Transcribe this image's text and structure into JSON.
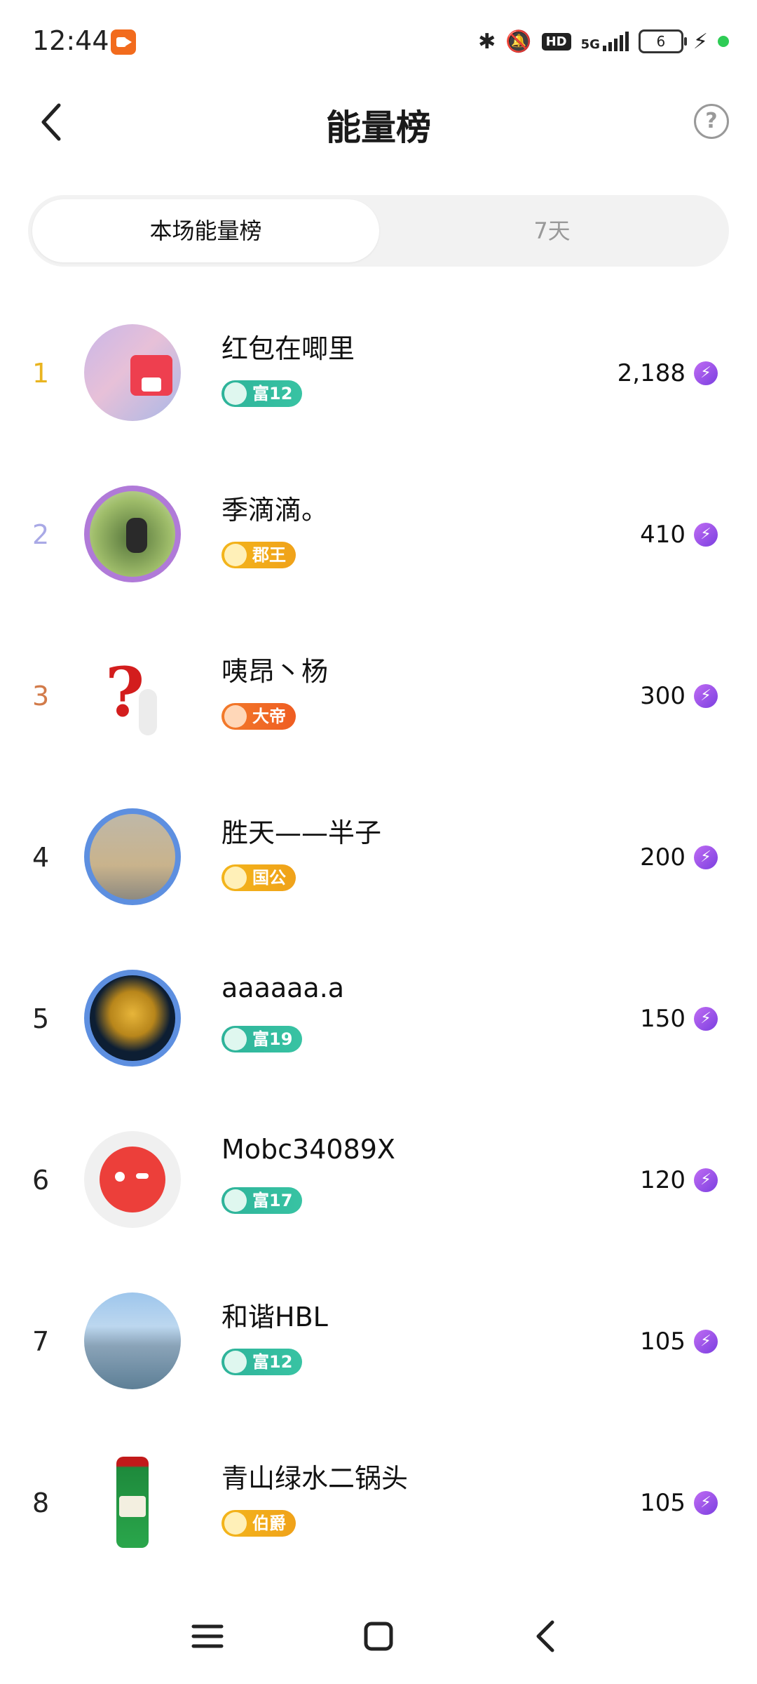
{
  "status_bar": {
    "time": "12:44",
    "signal": "5G",
    "hd": "HD",
    "battery_level": "6"
  },
  "header": {
    "title": "能量榜",
    "help": "?"
  },
  "tabs": [
    {
      "label": "本场能量榜",
      "active": true
    },
    {
      "label": "7天",
      "active": false
    }
  ],
  "ranking": [
    {
      "rank": "1",
      "name": "红包在唧里",
      "badge": "富12",
      "badge_style": "teal",
      "score": "2,188"
    },
    {
      "rank": "2",
      "name": "季滴滴。",
      "badge": "郡王",
      "badge_style": "gold",
      "score": "410"
    },
    {
      "rank": "3",
      "name": "咦昂丶杨",
      "badge": "大帝",
      "badge_style": "orange",
      "score": "300"
    },
    {
      "rank": "4",
      "name": "胜天——半子",
      "badge": "国公",
      "badge_style": "gold",
      "score": "200"
    },
    {
      "rank": "5",
      "name": "aaaaaa.a",
      "badge": "富19",
      "badge_style": "teal",
      "score": "150"
    },
    {
      "rank": "6",
      "name": "Mobc34089X",
      "badge": "富17",
      "badge_style": "teal",
      "score": "120"
    },
    {
      "rank": "7",
      "name": "和谐HBL",
      "badge": "富12",
      "badge_style": "teal",
      "score": "105"
    },
    {
      "rank": "8",
      "name": "青山绿水二锅头",
      "badge": "伯爵",
      "badge_style": "gold",
      "score": "105"
    }
  ],
  "colors": {
    "rank1": "#e9b420",
    "rank2": "#a9a9e6",
    "rank3": "#d27b4a",
    "energy_icon": "#9b4fe8"
  }
}
